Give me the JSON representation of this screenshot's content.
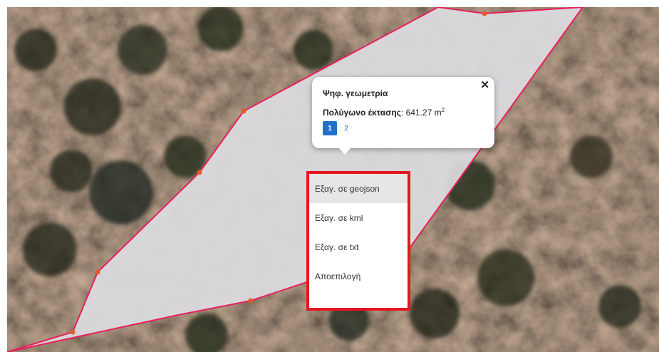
{
  "popup": {
    "title": "Ψηφ. γεωμετρία",
    "area_label": "Πολύγωνο έκτασης",
    "area_value": ": 641.27 m",
    "area_unit_exp": "2",
    "close_icon": "close-icon",
    "pages": [
      "1",
      "2"
    ],
    "active_page": "1"
  },
  "context_menu": {
    "items": [
      {
        "label": "Εξαγ. σε geojson",
        "hover": true
      },
      {
        "label": "Εξαγ. σε kml"
      },
      {
        "label": "Εξαγ. σε txt"
      },
      {
        "label": "Αποεπιλογή"
      }
    ],
    "highlight_color": "#e4161f"
  },
  "colors": {
    "polygon_fill": "#dcdce0",
    "polygon_stroke": "#e8205a",
    "vertex": "#e25a2a",
    "accent": "#1e73c9"
  }
}
